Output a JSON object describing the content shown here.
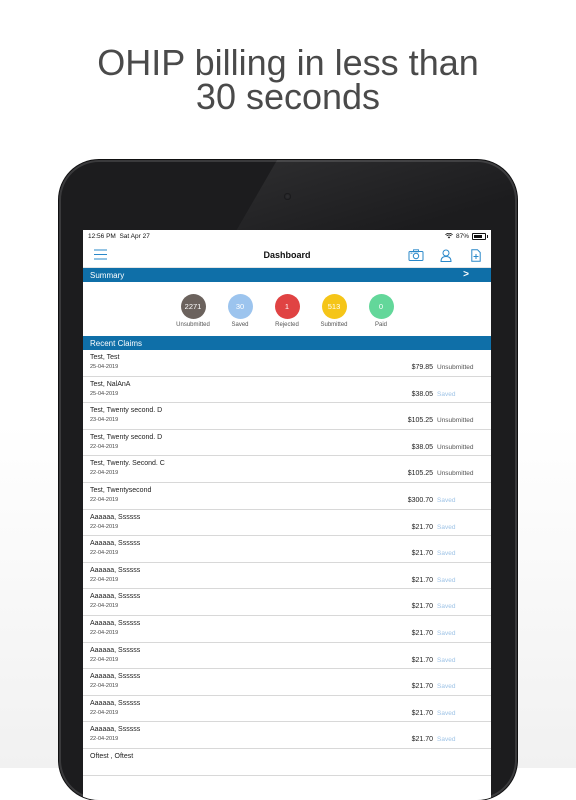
{
  "headline": {
    "line1": "OHIP billing in less than",
    "line2": "30 seconds"
  },
  "status_bar": {
    "time": "12:56 PM",
    "date": "Sat Apr 27",
    "battery": "87%"
  },
  "nav": {
    "title": "Dashboard"
  },
  "summary": {
    "label": "Summary",
    "arrow": ">",
    "stats": [
      {
        "value": "2271",
        "label": "Unsubmitted",
        "color": "#6b625d"
      },
      {
        "value": "30",
        "label": "Saved",
        "color": "#9cc4ee"
      },
      {
        "value": "1",
        "label": "Rejected",
        "color": "#e04343"
      },
      {
        "value": "513",
        "label": "Submitted",
        "color": "#f5c518"
      },
      {
        "value": "0",
        "label": "Paid",
        "color": "#63d79a"
      }
    ]
  },
  "recent_claims": {
    "label": "Recent Claims",
    "items": [
      {
        "name": "Test, Test",
        "date": "25-04-2019",
        "amount": "$79.85",
        "status": "Unsubmitted"
      },
      {
        "name": "Test, NalAnA",
        "date": "25-04-2019",
        "amount": "$38.05",
        "status": "Saved"
      },
      {
        "name": "Test, Twenty second. D",
        "date": "23-04-2019",
        "amount": "$105.25",
        "status": "Unsubmitted"
      },
      {
        "name": "Test, Twenty second. D",
        "date": "22-04-2019",
        "amount": "$38.05",
        "status": "Unsubmitted"
      },
      {
        "name": "Test, Twenty. Second. C",
        "date": "22-04-2019",
        "amount": "$105.25",
        "status": "Unsubmitted"
      },
      {
        "name": "Test, Twentysecond",
        "date": "22-04-2019",
        "amount": "$300.70",
        "status": "Saved"
      },
      {
        "name": "Aaaaaa, Ssssss",
        "date": "22-04-2019",
        "amount": "$21.70",
        "status": "Saved"
      },
      {
        "name": "Aaaaaa, Ssssss",
        "date": "22-04-2019",
        "amount": "$21.70",
        "status": "Saved"
      },
      {
        "name": "Aaaaaa, Ssssss",
        "date": "22-04-2019",
        "amount": "$21.70",
        "status": "Saved"
      },
      {
        "name": "Aaaaaa, Ssssss",
        "date": "22-04-2019",
        "amount": "$21.70",
        "status": "Saved"
      },
      {
        "name": "Aaaaaa, Ssssss",
        "date": "22-04-2019",
        "amount": "$21.70",
        "status": "Saved"
      },
      {
        "name": "Aaaaaa, Ssssss",
        "date": "22-04-2019",
        "amount": "$21.70",
        "status": "Saved"
      },
      {
        "name": "Aaaaaa, Ssssss",
        "date": "22-04-2019",
        "amount": "$21.70",
        "status": "Saved"
      },
      {
        "name": "Aaaaaa, Ssssss",
        "date": "22-04-2019",
        "amount": "$21.70",
        "status": "Saved"
      },
      {
        "name": "Aaaaaa, Ssssss",
        "date": "22-04-2019",
        "amount": "$21.70",
        "status": "Saved"
      },
      {
        "name": "Oftest , Oftest",
        "date": "",
        "amount": "",
        "status": ""
      }
    ]
  },
  "colors": {
    "accent": "#0f6fa8",
    "saved_status": "#9ec3e6"
  }
}
